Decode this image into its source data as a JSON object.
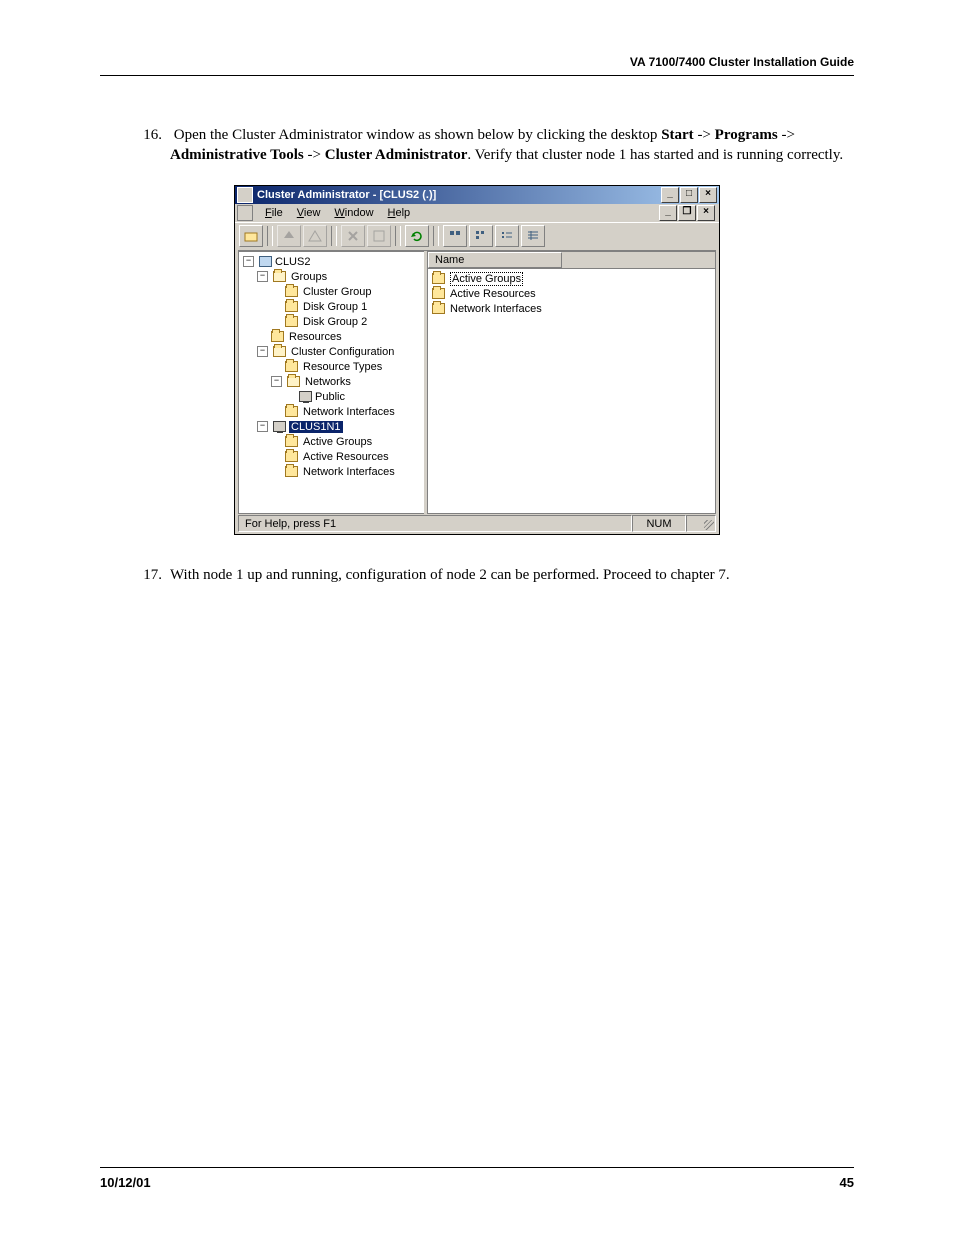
{
  "header": {
    "title": "VA 7100/7400 Cluster Installation Guide"
  },
  "steps": {
    "s16": {
      "num": "16.",
      "pre": "Open the Cluster Administrator window as shown below by clicking the desktop ",
      "b1": "Start",
      "a1": " -> ",
      "b2": "Programs",
      "a2": " -> ",
      "b3": "Administrative Tools",
      "a3": " -> ",
      "b4": "Cluster Administrator",
      "post": ".  Verify that cluster node 1 has started and is running correctly."
    },
    "s17": {
      "num": "17.",
      "text": "With node 1 up and running, configuration of node 2 can be performed.  Proceed to chapter 7."
    }
  },
  "window": {
    "title": "Cluster Administrator - [CLUS2 (.)]",
    "menus": {
      "file": "File",
      "view": "View",
      "window": "Window",
      "help": "Help"
    },
    "tree": {
      "root": "CLUS2",
      "groups": "Groups",
      "cluster_group": "Cluster Group",
      "disk_group_1": "Disk Group 1",
      "disk_group_2": "Disk Group 2",
      "resources": "Resources",
      "cluster_config": "Cluster Configuration",
      "resource_types": "Resource Types",
      "networks": "Networks",
      "public": "Public",
      "network_interfaces": "Network Interfaces",
      "node": "CLUS1N1",
      "active_groups": "Active Groups",
      "active_resources": "Active Resources",
      "node_net_if": "Network Interfaces"
    },
    "list": {
      "col_name": "Name",
      "items": [
        "Active Groups",
        "Active Resources",
        "Network Interfaces"
      ]
    },
    "status": {
      "help": "For Help, press F1",
      "num": "NUM"
    }
  },
  "footer": {
    "date": "10/12/01",
    "page": "45"
  }
}
